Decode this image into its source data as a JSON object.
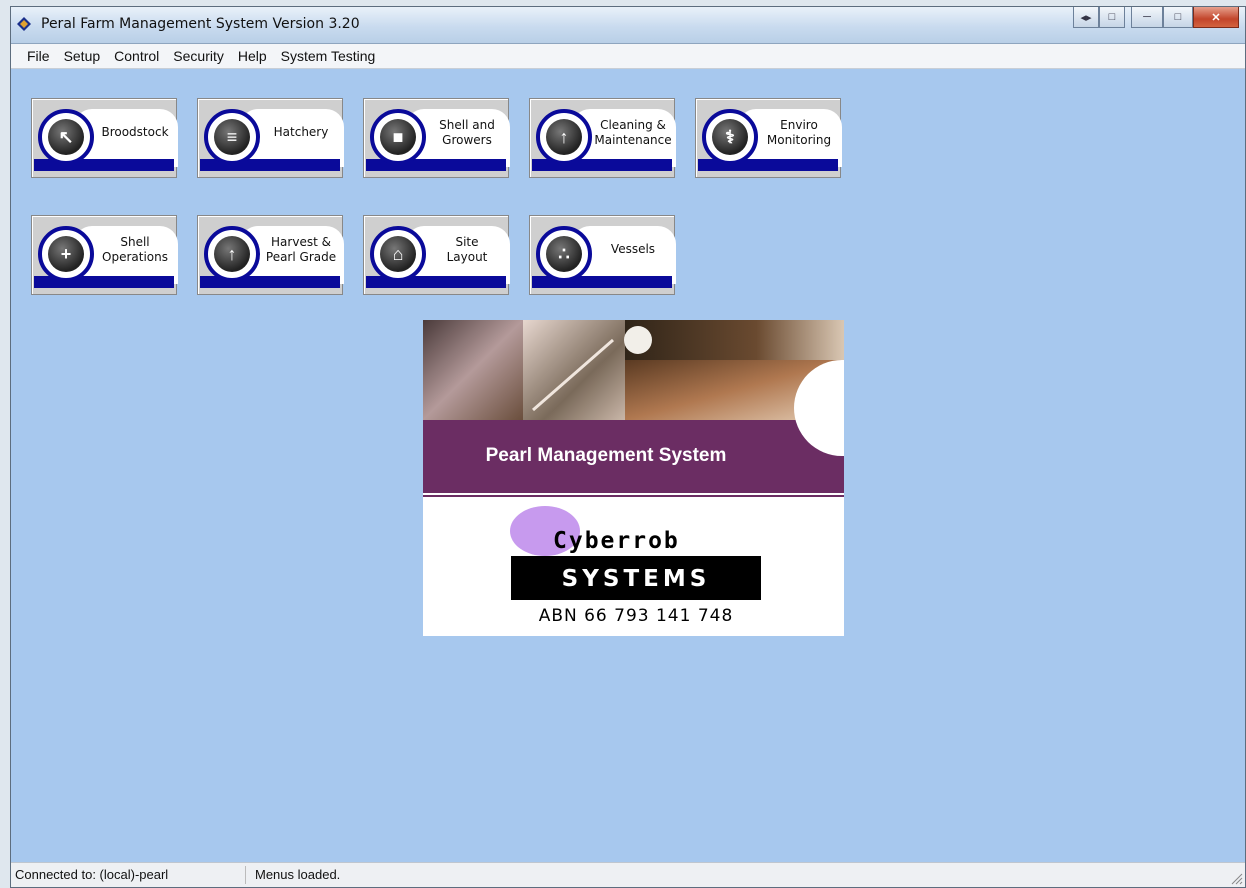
{
  "window": {
    "title": "Peral Farm Management System Version 3.20",
    "caption_buttons": [
      "minimize",
      "maximize",
      "close"
    ]
  },
  "menu": [
    {
      "label": "File",
      "accel": "F",
      "rest": "ile"
    },
    {
      "label": "Setup",
      "accel": "S",
      "rest": "etup"
    },
    {
      "label": "Control",
      "accel": "C",
      "rest": "ontrol"
    },
    {
      "label": "Security",
      "pre": "S",
      "accel": "e",
      "rest": "curity"
    },
    {
      "label": "Help",
      "accel": "H",
      "rest": "elp"
    },
    {
      "label": "System Testing",
      "pre": "Syst",
      "accel": "e",
      "rest": "m Testing"
    }
  ],
  "modules": [
    {
      "label": "Broodstock",
      "icon": "diver-icon"
    },
    {
      "label": "Hatchery",
      "icon": "basket-icon"
    },
    {
      "label": "Shell and\nGrowers",
      "line1": "Shell and",
      "line2": "Growers",
      "icon": "truck-icon"
    },
    {
      "label": "Cleaning &\nMaintenance",
      "line1": "Cleaning &",
      "line2": "Maintenance",
      "icon": "upload-shell-icon"
    },
    {
      "label": "Enviro\nMonitoring",
      "line1": "Enviro",
      "line2": "Monitoring",
      "icon": "microscope-icon"
    },
    {
      "label": "Shell\nOperations",
      "line1": "Shell",
      "line2": "Operations",
      "icon": "plus-shell-icon"
    },
    {
      "label": "Harvest &\nPearl Grade",
      "line1": "Harvest &",
      "line2": "Pearl Grade",
      "icon": "upload-shell-icon"
    },
    {
      "label": "Site\nLayout",
      "line1": "Site",
      "line2": "Layout",
      "icon": "site-houses-icon"
    },
    {
      "label": "Vessels",
      "icon": "vessel-icon"
    }
  ],
  "splash": {
    "title": "Pearl Management System",
    "logo_word": "Cyberrob",
    "logo_box": "SYSTEMS",
    "abn": "ABN 66 793 141 748"
  },
  "status": {
    "connection": "Connected to: (local)-pearl",
    "message": "Menus loaded."
  },
  "colors": {
    "desktop_bg": "#a7c8ee",
    "tile_accent": "#0a0a9a",
    "splash_band": "#6b2d63"
  }
}
